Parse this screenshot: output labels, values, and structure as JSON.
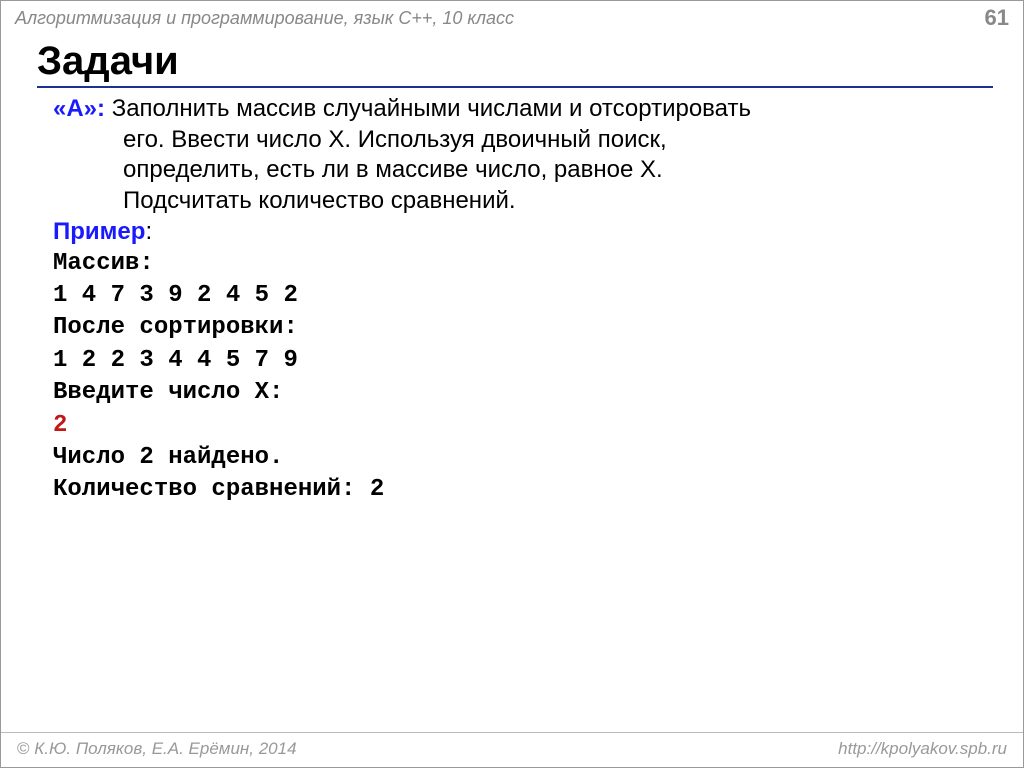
{
  "header": {
    "course": "Алгоритмизация и программирование, язык C++, 10 класс",
    "page": "61"
  },
  "title": "Задачи",
  "task": {
    "label": "«A»:",
    "line1": " Заполнить массив случайными числами и отсортировать",
    "line2": "его.  Ввести число X. Используя двоичный поиск,",
    "line3": "определить, есть ли в массиве число, равное X.",
    "line4": "Подсчитать количество сравнений."
  },
  "example": {
    "label": "Пример",
    "colon": ":",
    "lines": {
      "l1": "Массив:",
      "l2": "1 4 7 3 9 2 4 5 2",
      "l3": "После сортировки:",
      "l4": "1 2 2 3 4 4 5 7 9",
      "l5": "Введите число X:",
      "l6": "2",
      "l7": "Число 2 найдено.",
      "l8": "Количество сравнений: 2"
    }
  },
  "footer": {
    "copyright": " К.Ю. Поляков, Е.А. Ерёмин, 2014",
    "url": "http://kpolyakov.spb.ru"
  }
}
